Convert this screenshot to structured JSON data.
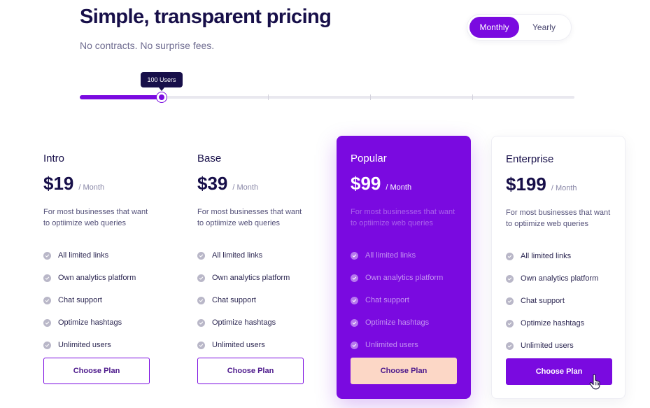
{
  "header": {
    "title": "Simple, transparent pricing",
    "subtitle": "No contracts. No surprise fees."
  },
  "billing_toggle": {
    "options": [
      "Monthly",
      "Yearly"
    ],
    "selected": "Monthly"
  },
  "user_slider": {
    "tooltip": "100 Users",
    "value_fraction": 0.165,
    "tick_fractions": [
      0.38,
      0.587,
      0.793
    ]
  },
  "plans": [
    {
      "name": "Intro",
      "price": "$19",
      "period": "/ Month",
      "description": "For most businesses that want to optiimize web queries",
      "features": [
        "All limited links",
        "Own analytics platform",
        "Chat support",
        "Optimize hashtags",
        "Unlimited users"
      ],
      "cta": "Choose Plan"
    },
    {
      "name": "Base",
      "price": "$39",
      "period": "/ Month",
      "description": "For most businesses that want to optiimize web queries",
      "features": [
        "All limited links",
        "Own analytics platform",
        "Chat support",
        "Optimize hashtags",
        "Unlimited users"
      ],
      "cta": "Choose Plan"
    },
    {
      "name": "Popular",
      "price": "$99",
      "period": "/ Month",
      "description": "For most businesses that want to optiimize web queries",
      "features": [
        "All limited links",
        "Own analytics platform",
        "Chat support",
        "Optimize hashtags",
        "Unlimited users"
      ],
      "cta": "Choose Plan"
    },
    {
      "name": "Enterprise",
      "price": "$199",
      "period": "/ Month",
      "description": "For most businesses that want to optiimize web queries",
      "features": [
        "All limited links",
        "Own analytics platform",
        "Chat support",
        "Optimize hashtags",
        "Unlimited users"
      ],
      "cta": "Choose Plan"
    }
  ],
  "icons": {
    "feature": "check-circle-icon",
    "cursor": "hand-pointer-icon"
  },
  "colors": {
    "accent": "#7a0ae0",
    "heading": "#170f49",
    "peach_button": "#fcd7c6"
  }
}
